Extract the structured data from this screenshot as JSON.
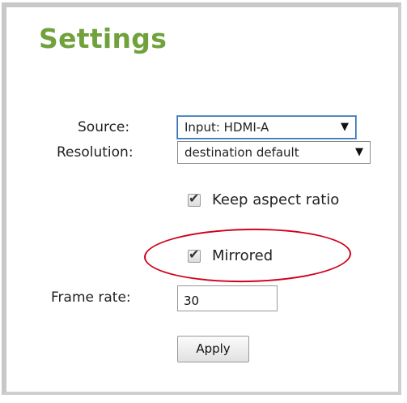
{
  "settings": {
    "title": "Settings",
    "source": {
      "label": "Source:",
      "value": "Input: HDMI-A",
      "arrow": "▼"
    },
    "resolution": {
      "label": "Resolution:",
      "value": "destination default",
      "arrow": "▼"
    },
    "keep_aspect_ratio": {
      "label": "Keep aspect ratio",
      "checked": true
    },
    "mirrored": {
      "label": "Mirrored",
      "checked": true
    },
    "frame_rate": {
      "label": "Frame rate:",
      "value": "30"
    },
    "apply_label": "Apply"
  },
  "colors": {
    "title": "#70a13c",
    "highlight_ellipse": "#d0021b",
    "border": "#c8c8c8"
  },
  "icons": {
    "checkmark": "check-icon",
    "dropdown": "chevron-down-icon"
  }
}
